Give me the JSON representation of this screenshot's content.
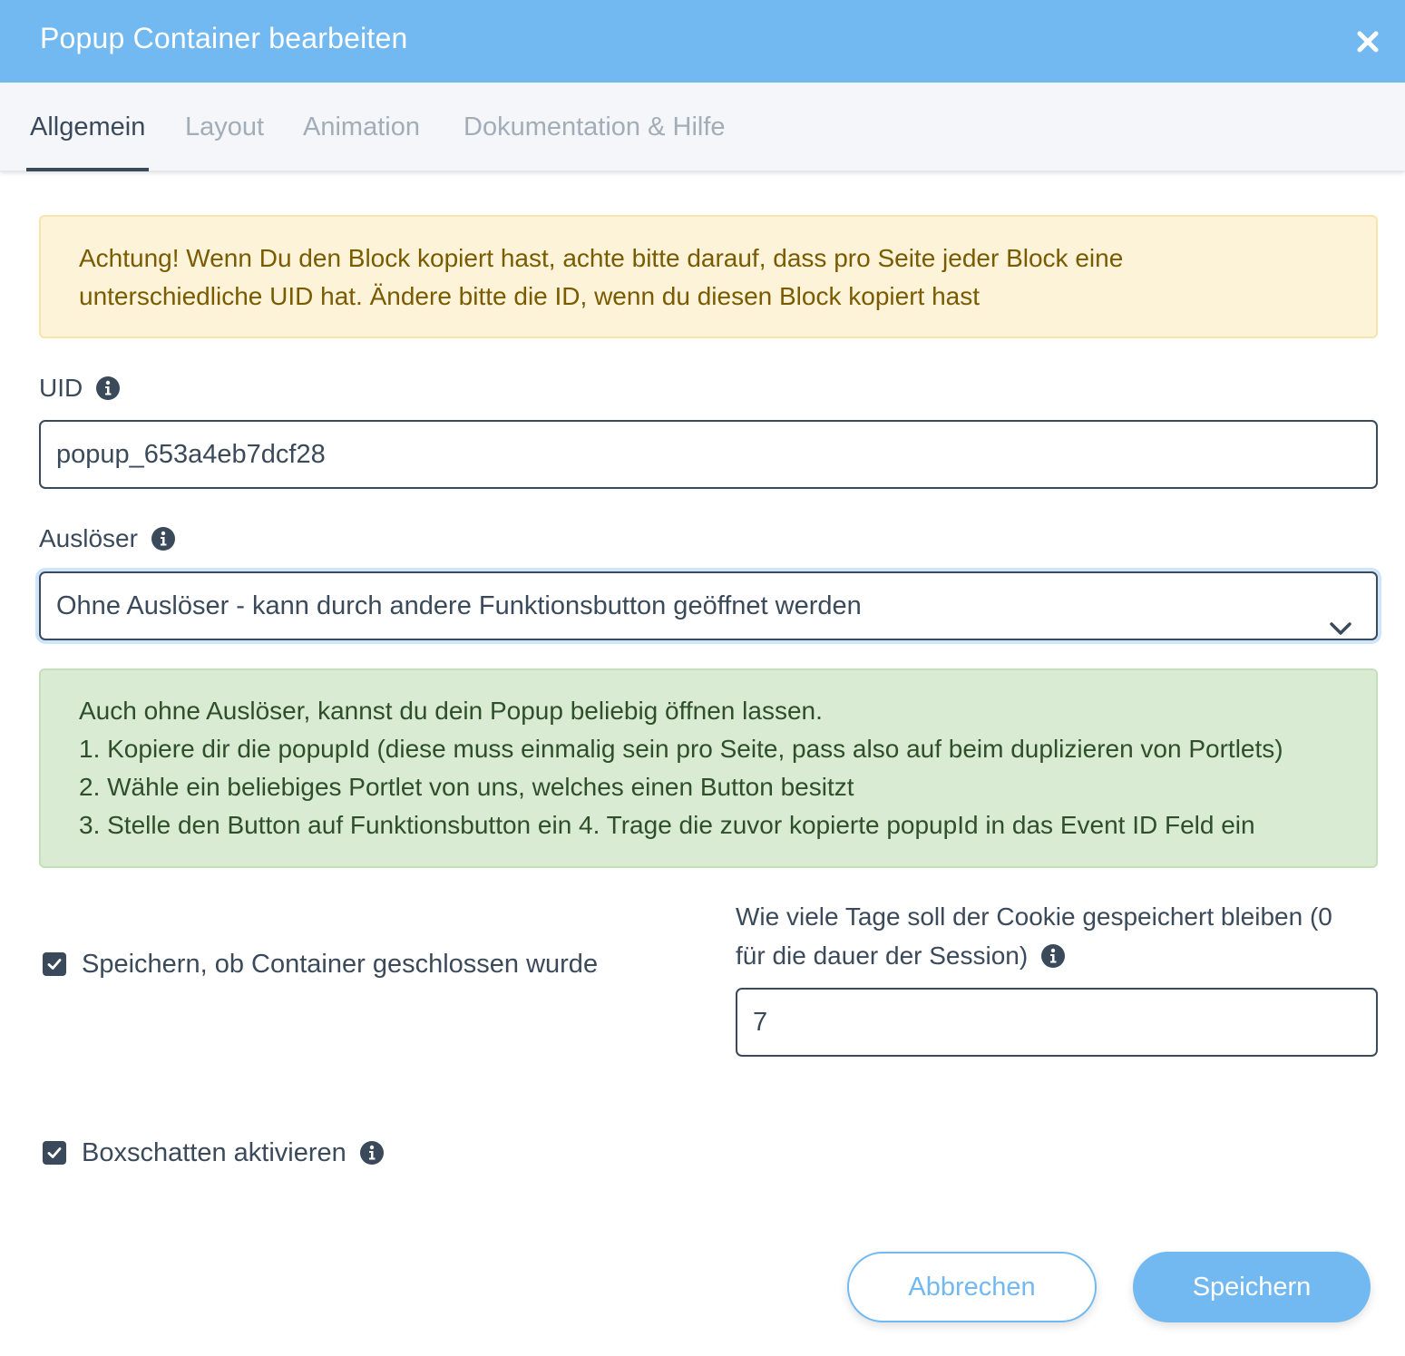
{
  "header": {
    "title": "Popup Container bearbeiten",
    "close_icon": "close-icon"
  },
  "tabs": [
    {
      "label": "Allgemein",
      "active": true
    },
    {
      "label": "Layout",
      "active": false
    },
    {
      "label": "Animation",
      "active": false
    },
    {
      "label": "Dokumentation & Hilfe",
      "active": false
    }
  ],
  "warning": {
    "lines": [
      "Achtung! Wenn Du den Block kopiert hast, achte bitte darauf, dass pro Seite jeder Block eine",
      "unterschiedliche UID hat. Ändere bitte die ID, wenn du diesen Block kopiert hast"
    ]
  },
  "uid": {
    "label": "UID",
    "value": "popup_653a4eb7dcf28"
  },
  "trigger": {
    "label": "Auslöser",
    "selected": "Ohne Auslöser - kann durch andere Funktionsbutton geöffnet werden"
  },
  "info": {
    "lines": [
      "Auch ohne Auslöser, kannst du dein Popup beliebig öffnen lassen.",
      "1. Kopiere dir die popupId (diese muss einmalig sein pro Seite, pass also auf beim duplizieren von Portlets)",
      "2. Wähle ein beliebiges Portlet von uns, welches einen Button besitzt",
      "3. Stelle den Button auf Funktionsbutton ein 4. Trage die zuvor kopierte popupId in das Event ID Feld ein"
    ]
  },
  "save_closed": {
    "label": "Speichern, ob Container geschlossen wurde",
    "checked": true
  },
  "cookie_days": {
    "label_line1": "Wie viele Tage soll der Cookie gespeichert bleiben (0",
    "label_line2": "für die dauer der Session)",
    "value": "7"
  },
  "box_shadow": {
    "label": "Boxschatten aktivieren",
    "checked": true
  },
  "footer": {
    "cancel_label": "Abbrechen",
    "save_label": "Speichern"
  },
  "colors": {
    "accent": "#72b9f2",
    "text": "#3b4a5a",
    "warning_bg": "#fcf3d8",
    "success_bg": "#d9ebd3"
  }
}
